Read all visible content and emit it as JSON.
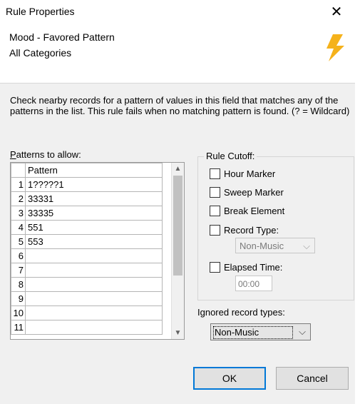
{
  "window": {
    "title": "Rule Properties",
    "close_glyph": "✕"
  },
  "header": {
    "rule_name": "Mood - Favored Pattern",
    "scope": "All Categories",
    "icon": "lightning-bolt-icon",
    "icon_color": "#f5b21b"
  },
  "description": "Check nearby records for a pattern of values in this field that matches any of the patterns in the list. This rule fails when no matching pattern is found. (? = Wildcard)",
  "patterns": {
    "label_prefix": "P",
    "label_rest": "atterns to allow:",
    "column_header": "Pattern",
    "rows": [
      {
        "num": "1",
        "value": "1?????1"
      },
      {
        "num": "2",
        "value": "33331"
      },
      {
        "num": "3",
        "value": "33335"
      },
      {
        "num": "4",
        "value": "551"
      },
      {
        "num": "5",
        "value": "553"
      },
      {
        "num": "6",
        "value": ""
      },
      {
        "num": "7",
        "value": ""
      },
      {
        "num": "8",
        "value": ""
      },
      {
        "num": "9",
        "value": ""
      },
      {
        "num": "10",
        "value": ""
      },
      {
        "num": "11",
        "value": ""
      }
    ]
  },
  "cutoff": {
    "title": "Rule Cutoff:",
    "hour_marker": "Hour Marker",
    "sweep_marker": "Sweep Marker",
    "break_element": "Break Element",
    "record_type": "Record Type:",
    "record_type_value": "Non-Music",
    "elapsed_time": "Elapsed Time:",
    "elapsed_time_value": "00:00"
  },
  "ignored": {
    "label": "Ignored record types:",
    "value": "Non-Music"
  },
  "buttons": {
    "ok": "OK",
    "cancel": "Cancel"
  }
}
